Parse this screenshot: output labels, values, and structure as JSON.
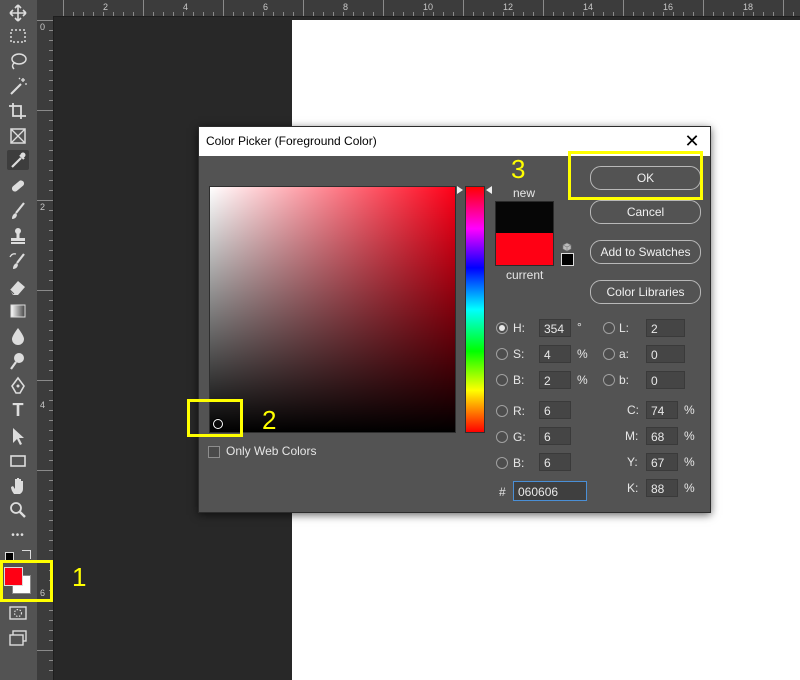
{
  "colors": {
    "foreground": "#ff0014",
    "background": "#ffffff",
    "new_color": "#060606",
    "current_color": "#ff0014",
    "highlight": "#ffff00"
  },
  "toolbar": {
    "icons": [
      "move-icon",
      "marquee-icon",
      "lasso-icon",
      "magic-wand-icon",
      "crop-icon",
      "frame-icon",
      "eyedropper-icon",
      "healing-brush-icon",
      "brush-icon",
      "clone-stamp-icon",
      "history-brush-icon",
      "eraser-icon",
      "gradient-icon",
      "blur-icon",
      "dodge-icon",
      "pen-icon",
      "type-icon",
      "path-selection-icon",
      "rectangle-icon",
      "hand-icon",
      "zoom-icon",
      "more-icon"
    ],
    "type_glyph": "T",
    "more_glyph": "•••"
  },
  "ruler": {
    "top_labels": [
      "2",
      "4",
      "6",
      "8",
      "10",
      "12",
      "14",
      "16",
      "18"
    ],
    "left_labels": [
      "0",
      "2",
      "4",
      "6"
    ]
  },
  "dialog": {
    "title": "Color Picker (Foreground Color)",
    "close_glyph": "✕",
    "label_new": "new",
    "label_current": "current",
    "buttons": {
      "ok": "OK",
      "cancel": "Cancel",
      "add_swatches": "Add to Swatches",
      "color_libraries": "Color Libraries"
    },
    "only_web_colors": "Only Web Colors",
    "hsb": {
      "h": {
        "label": "H:",
        "value": "354",
        "unit": "°"
      },
      "s": {
        "label": "S:",
        "value": "4",
        "unit": "%"
      },
      "b": {
        "label": "B:",
        "value": "2",
        "unit": "%"
      }
    },
    "rgb": {
      "r": {
        "label": "R:",
        "value": "6"
      },
      "g": {
        "label": "G:",
        "value": "6"
      },
      "b": {
        "label": "B:",
        "value": "6"
      }
    },
    "lab": {
      "l": {
        "label": "L:",
        "value": "2"
      },
      "a": {
        "label": "a:",
        "value": "0"
      },
      "b": {
        "label": "b:",
        "value": "0"
      }
    },
    "cmyk": {
      "c": {
        "label": "C:",
        "value": "74",
        "unit": "%"
      },
      "m": {
        "label": "M:",
        "value": "68",
        "unit": "%"
      },
      "y": {
        "label": "Y:",
        "value": "67",
        "unit": "%"
      },
      "k": {
        "label": "K:",
        "value": "88",
        "unit": "%"
      }
    },
    "hex": {
      "label": "#",
      "value": "060606"
    }
  },
  "annotations": {
    "one": "1",
    "two": "2",
    "three": "3"
  }
}
